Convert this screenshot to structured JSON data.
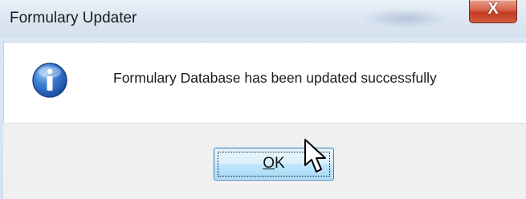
{
  "window": {
    "title": "Formulary Updater",
    "close_label": "X"
  },
  "message": {
    "text": "Formulary Database has been updated successfully",
    "icon": "info-icon"
  },
  "buttons": {
    "ok_accel": "O",
    "ok_rest": "K"
  },
  "colors": {
    "titlebar": "#dde7f3",
    "close_button": "#c33b22",
    "content_bg": "#ffffff",
    "footer_bg": "#f0f0f0",
    "ok_button_border": "#3c7fb1",
    "info_icon": "#2a64b8"
  }
}
